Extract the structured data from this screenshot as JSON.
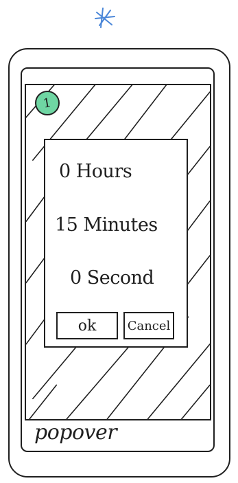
{
  "dialog": {
    "hours_label": "0 Hours",
    "minutes_label": "15 Minutes",
    "seconds_label": "0 Second",
    "ok_label": "ok",
    "cancel_label": "Cancel"
  },
  "badge": {
    "number": "1",
    "color": "#6fd6a3"
  },
  "caption": "popover",
  "mark": {
    "color": "#4a86d8"
  }
}
